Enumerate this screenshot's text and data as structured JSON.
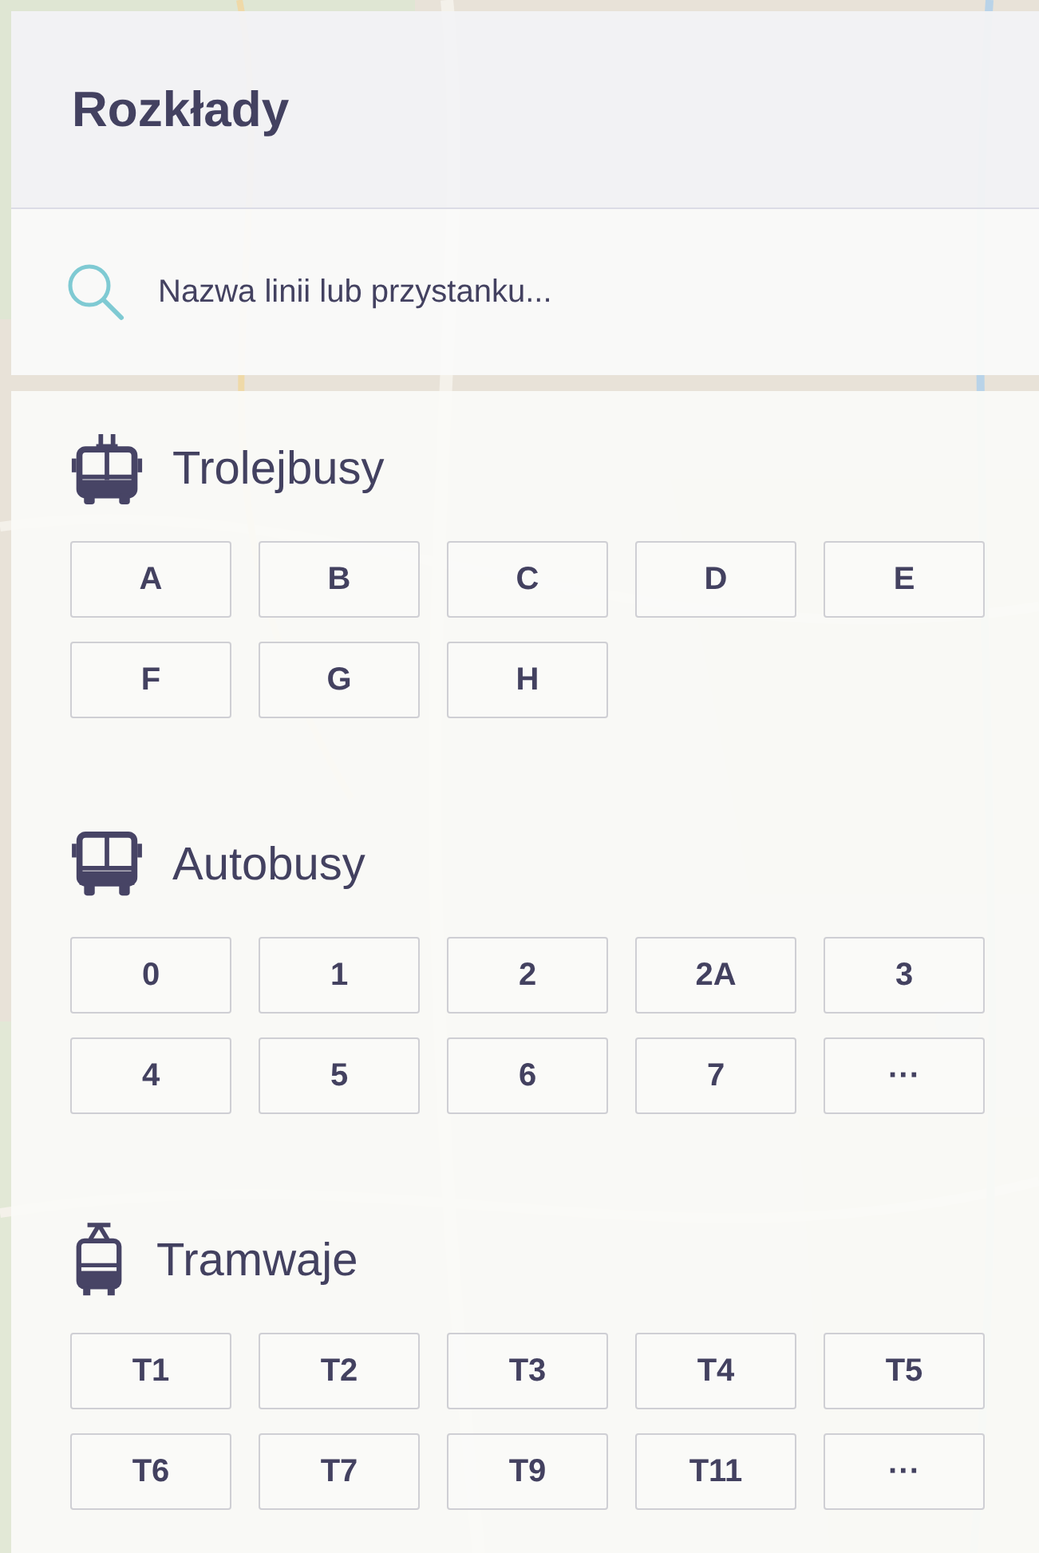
{
  "title": "Rozkłady",
  "search": {
    "placeholder": "Nazwa linii lub przystanku..."
  },
  "sections": [
    {
      "kind": "trolleybus",
      "label": "Trolejbusy",
      "lines": [
        "A",
        "B",
        "C",
        "D",
        "E",
        "F",
        "G",
        "H"
      ]
    },
    {
      "kind": "bus",
      "label": "Autobusy",
      "lines": [
        "0",
        "1",
        "2",
        "2A",
        "3",
        "4",
        "5",
        "6",
        "7",
        "···"
      ]
    },
    {
      "kind": "tram",
      "label": "Tramwaje",
      "lines": [
        "T1",
        "T2",
        "T3",
        "T4",
        "T5",
        "T6",
        "T7",
        "T9",
        "T11",
        "···"
      ]
    }
  ]
}
